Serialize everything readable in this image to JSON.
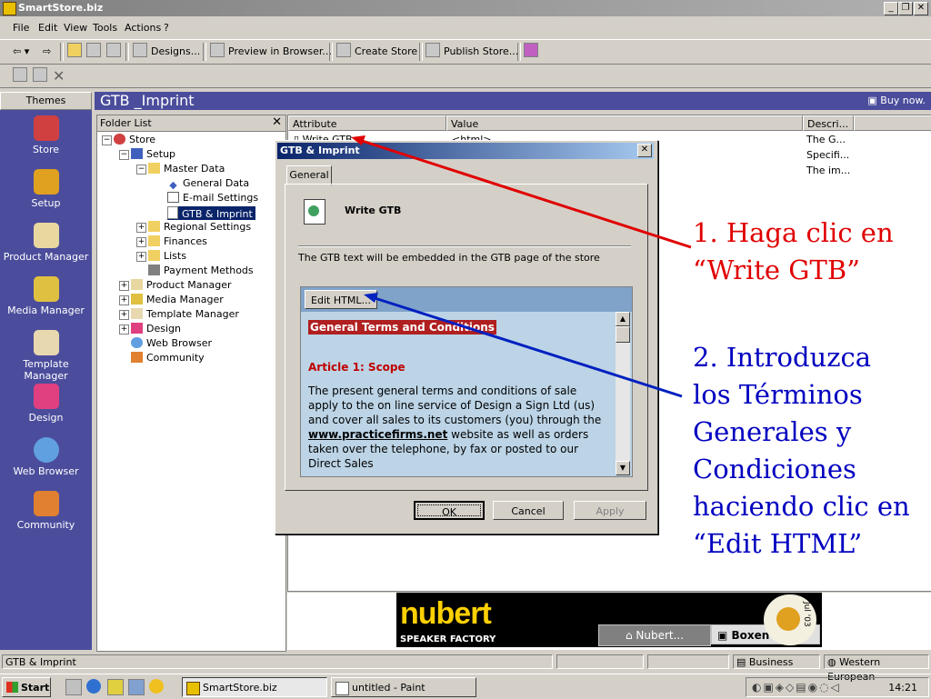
{
  "window": {
    "title": "SmartStore.biz"
  },
  "menu": [
    "File",
    "Edit",
    "View",
    "Tools",
    "Actions",
    "?"
  ],
  "toolbar": {
    "designs": "Designs...",
    "preview": "Preview in Browser...",
    "create_store": "Create Store",
    "publish_store": "Publish Store..."
  },
  "themes": {
    "header": "Themes",
    "items": [
      {
        "label": "Store",
        "icon": "store-icon",
        "color": "#d04040"
      },
      {
        "label": "Setup",
        "icon": "setup-icon",
        "color": "#e0a020"
      },
      {
        "label": "Product Manager",
        "icon": "product-manager-icon",
        "color": "#e8d8a0"
      },
      {
        "label": "Media Manager",
        "icon": "media-manager-icon",
        "color": "#e0c040"
      },
      {
        "label": "Template Manager",
        "icon": "template-manager-icon",
        "color": "#e8d8b0"
      },
      {
        "label": "Design",
        "icon": "design-icon",
        "color": "#e04080"
      },
      {
        "label": "Web Browser",
        "icon": "web-browser-icon",
        "color": "#60a0e0"
      },
      {
        "label": "Community",
        "icon": "community-icon",
        "color": "#e08030"
      }
    ]
  },
  "main": {
    "title": "GTB _Imprint",
    "buy_now": "Buy now."
  },
  "folder_list": {
    "header": "Folder List",
    "nodes": [
      {
        "label": "Store"
      },
      {
        "label": "Setup"
      },
      {
        "label": "Master Data"
      },
      {
        "label": "General Data"
      },
      {
        "label": "E-mail Settings"
      },
      {
        "label": "GTB & Imprint"
      },
      {
        "label": "Regional Settings"
      },
      {
        "label": "Finances"
      },
      {
        "label": "Lists"
      },
      {
        "label": "Payment Methods"
      },
      {
        "label": "Product Manager"
      },
      {
        "label": "Media Manager"
      },
      {
        "label": "Template Manager"
      },
      {
        "label": "Design"
      },
      {
        "label": "Web Browser"
      },
      {
        "label": "Community"
      }
    ]
  },
  "attribute_list": {
    "columns": [
      "Attribute",
      "Value",
      "Descri..."
    ],
    "rows": [
      {
        "attribute": "Write GTB",
        "value": "<html>",
        "description": "The G..."
      },
      {
        "attribute": "",
        "value": "",
        "description": "Specifi..."
      },
      {
        "attribute": "",
        "value": "",
        "description": "The im..."
      }
    ]
  },
  "dialog": {
    "title": "GTB & Imprint",
    "tab": "General",
    "heading": "Write GTB",
    "description": "The GTB text will be embedded in the GTB page of the store",
    "edit_html": "Edit HTML...",
    "content": {
      "section_title": "General Terms and Conditions",
      "article_title": "Article 1: Scope",
      "paragraph_before_link": "The present general terms and conditions of sale apply to the on line service of Design a Sign Ltd (us) and cover all sales to its customers (you) through the",
      "link": "www.practicefirms.net",
      "paragraph_after_link": "website as well as orders taken over the telephone, by fax or posted to our Direct Sales"
    },
    "ok": "OK",
    "cancel": "Cancel",
    "apply": "Apply"
  },
  "annotations": {
    "step1": [
      "1. Haga clic en",
      "“Write GTB”"
    ],
    "step2": [
      "2. Introduzca",
      "los Términos",
      "Generales y",
      "Condiciones",
      "haciendo clic en",
      "“Edit HTML”"
    ],
    "step1_color": "#e00000",
    "step2_color": "#0000c0"
  },
  "banner": {
    "brand": "nubert",
    "tagline": "SPEAKER FACTORY",
    "tab1": "Nubert...",
    "tab2": "Boxen",
    "badge": "Jul '03"
  },
  "statusbar": {
    "left": "GTB & Imprint",
    "category": "Business",
    "encoding": "Western European"
  },
  "taskbar": {
    "start": "Start",
    "tasks": [
      "SmartStore.biz",
      "untitled - Paint"
    ],
    "clock": "14:21"
  }
}
